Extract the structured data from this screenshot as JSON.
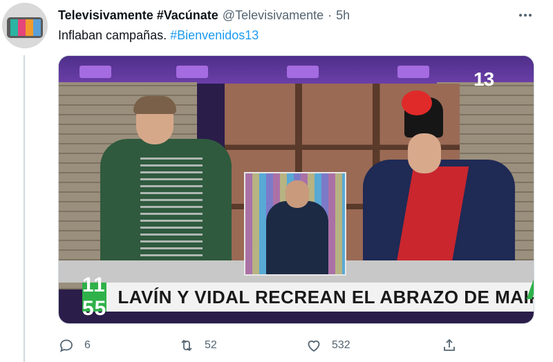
{
  "tweet": {
    "author_name": "Televisivamente #Vacúnate",
    "handle": "@Televisivamente",
    "separator": "·",
    "time": "5h",
    "more_icon": "more-horizontal-icon",
    "text_plain": "Inflaban campañas.",
    "hashtag": "#Bienvenidos13",
    "avatar_icon": "tv-logo-avatar",
    "avatar_colors": [
      "#2bb3a3",
      "#e5457a",
      "#f29a2e",
      "#5aa0d8"
    ]
  },
  "media": {
    "channel_logo": "13",
    "clock": "11 55",
    "headline": "LAVÍN Y VIDAL RECREAN EL ABRAZO DE MAIPÚ",
    "accent_color": "#2fb14a"
  },
  "actions": {
    "reply": {
      "icon": "reply-icon",
      "count": "6"
    },
    "retweet": {
      "icon": "retweet-icon",
      "count": "52"
    },
    "like": {
      "icon": "heart-icon",
      "count": "532"
    },
    "share": {
      "icon": "share-icon"
    }
  }
}
